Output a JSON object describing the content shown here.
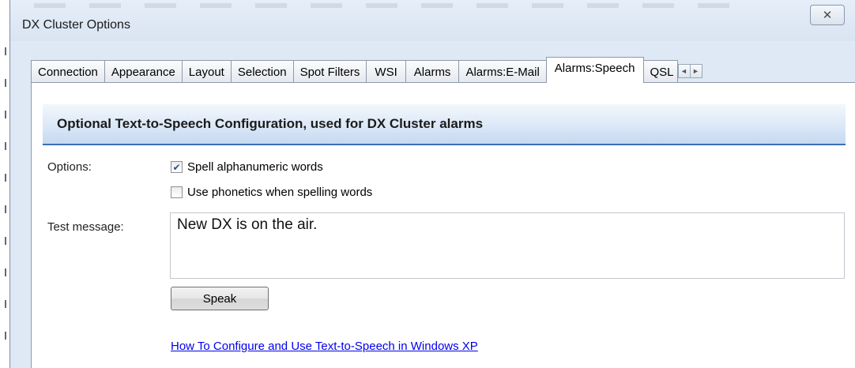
{
  "window": {
    "title": "DX Cluster Options",
    "close_glyph": "✕"
  },
  "tabs": [
    {
      "label": "Connection",
      "active": false
    },
    {
      "label": "Appearance",
      "active": false
    },
    {
      "label": "Layout",
      "active": false
    },
    {
      "label": "Selection",
      "active": false
    },
    {
      "label": "Spot Filters",
      "active": false
    },
    {
      "label": "WSI",
      "active": false
    },
    {
      "label": "Alarms",
      "active": false
    },
    {
      "label": "Alarms:E-Mail",
      "active": false
    },
    {
      "label": "Alarms:Speech",
      "active": true
    },
    {
      "label": "QSL",
      "active": false
    }
  ],
  "tab_scroll": {
    "left_glyph": "◄",
    "right_glyph": "►"
  },
  "panel": {
    "header": "Optional Text-to-Speech Configuration, used for DX Cluster alarms",
    "options_label": "Options:",
    "options": [
      {
        "label": "Spell alphanumeric words",
        "checked": true
      },
      {
        "label": "Use phonetics when spelling words",
        "checked": false
      }
    ],
    "test_message_label": "Test message:",
    "test_message_value": "New DX is on the air.",
    "speak_label": "Speak",
    "help_link": "How To Configure and Use Text-to-Speech in Windows XP"
  },
  "colors": {
    "header_rule": "#3b6fb6",
    "link": "#0000ee",
    "window_bg": "#dfe9f5"
  }
}
